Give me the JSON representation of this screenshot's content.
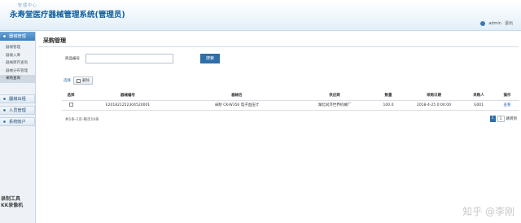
{
  "header": {
    "subtitle": "管理中心",
    "title": "永寿堂医疗器械管理系统(管理员)",
    "user": "admin",
    "logout": "退出"
  },
  "sidebar": {
    "section1": "器械管理",
    "items": [
      "器械管理",
      "器械入库",
      "器械库存查询",
      "器械分布管理",
      "采购查询"
    ],
    "section2": "器械出租",
    "section3": "人员管理",
    "section4": "系统帐户"
  },
  "main": {
    "title": "采购管理",
    "search_label": "商品编号",
    "search_value": "",
    "search_button": "搜索",
    "select_all": "选择",
    "delete_button": "删除",
    "columns": [
      "选择",
      "器械编号",
      "器械名",
      "供应商",
      "数量",
      "采购日期",
      "采购人",
      "操作"
    ],
    "rows": [
      [
        "",
        "E201821252304520001",
        "卓耐 CK-W356 电子血压计",
        "湖北同济世界机械厂",
        "100.0",
        "2018-4-25 0:00:00",
        "G001",
        "查看"
      ]
    ],
    "pager_info": "共1条-1页-每页10条",
    "current_page": "1",
    "page_input": "1",
    "goto": "跳转到"
  },
  "watermarks": {
    "left_line1": "录制工具",
    "left_line2": "KK录像机",
    "right": "知乎 @李刚"
  },
  "colors": {
    "accent": "#2f6ea8",
    "title": "#0f5d9c"
  }
}
